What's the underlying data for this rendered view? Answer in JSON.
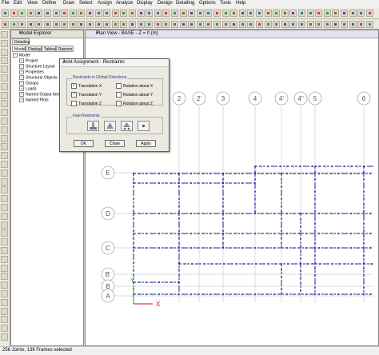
{
  "menu": {
    "items": [
      "File",
      "Edit",
      "View",
      "Define",
      "Draw",
      "Select",
      "Assign",
      "Analyze",
      "Display",
      "Design",
      "Detailing",
      "Options",
      "Tools",
      "Help"
    ]
  },
  "explorer": {
    "title": "Model Explorer",
    "close": "×",
    "tabs": [
      {
        "label": "Detailing"
      },
      {
        "label": "Model"
      },
      {
        "label": "Display"
      },
      {
        "label": "Tables"
      },
      {
        "label": "Reports"
      }
    ],
    "tree": [
      {
        "label": "Model",
        "toggle": "−"
      },
      {
        "label": "Project",
        "toggle": "+"
      },
      {
        "label": "Structure Layout",
        "toggle": "+"
      },
      {
        "label": "Properties",
        "toggle": "+"
      },
      {
        "label": "Structural Objects",
        "toggle": "+"
      },
      {
        "label": "Groups",
        "toggle": "+"
      },
      {
        "label": "Loads",
        "toggle": "+"
      },
      {
        "label": "Named Output Items",
        "toggle": "+"
      },
      {
        "label": "Named Plots",
        "toggle": "+"
      }
    ]
  },
  "plan": {
    "title": "Plan View - BASE - Z = 0 (m)",
    "close": "×",
    "grid_cols": [
      "2",
      "2'",
      "3",
      "4",
      "4'",
      "4''",
      "5",
      "6"
    ],
    "grid_rows": [
      "E",
      "D",
      "C",
      "B'",
      "B",
      "A"
    ],
    "axis_x": "X",
    "axis_y": "Y"
  },
  "dialog": {
    "title": "Joint Assignment - Restraints",
    "close": "×",
    "restraints_label": "Restraints in Global Directions",
    "checks": [
      {
        "label": "Translation  X",
        "checked": true
      },
      {
        "label": "Rotation about  X",
        "checked": false
      },
      {
        "label": "Translation  Y",
        "checked": true
      },
      {
        "label": "Rotation about  Y",
        "checked": false
      },
      {
        "label": "Translation  Z",
        "checked": false
      },
      {
        "label": "Rotation about  Z",
        "checked": false
      }
    ],
    "check_mark": "✓",
    "fast_label": "Fast Restraints",
    "buttons": {
      "ok": "OK",
      "close": "Close",
      "apply": "Apply"
    }
  },
  "status": {
    "text": "256 Joints, 136 Frames selected"
  },
  "colors": {
    "selected": "#1c1c9c",
    "grid": "#bdbdbd",
    "axis_x": "#d01010",
    "axis_y": "#10a010",
    "dialog_label": "#1a3c8a"
  }
}
